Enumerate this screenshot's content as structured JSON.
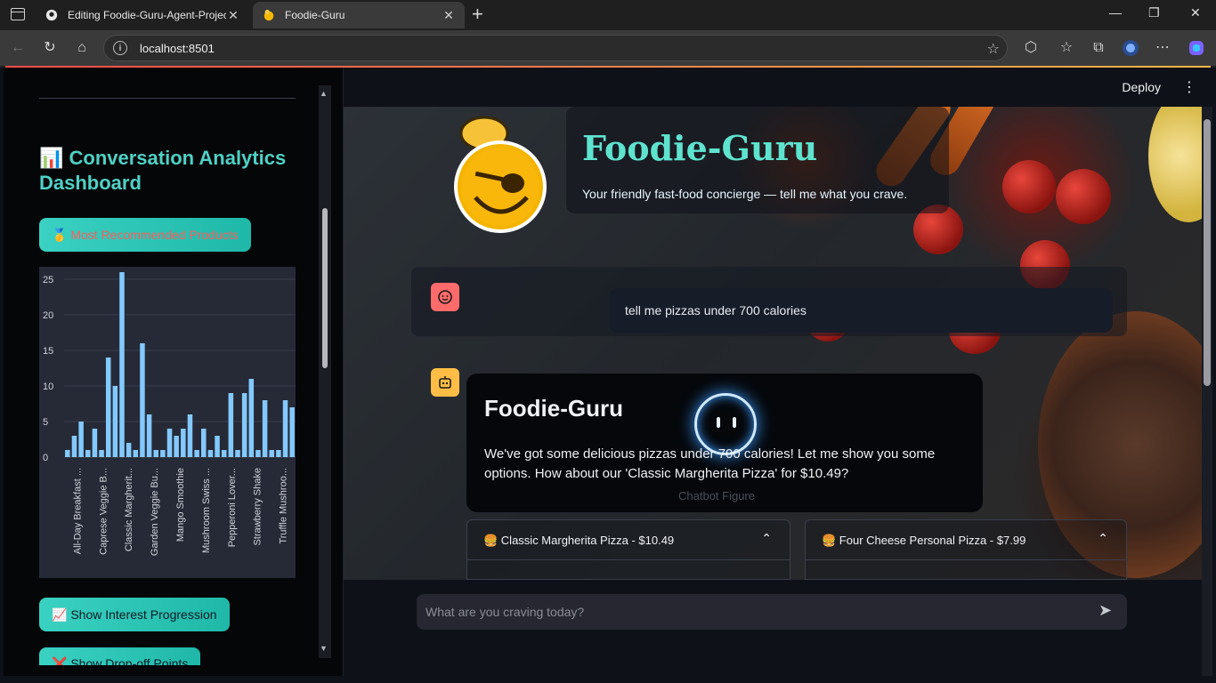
{
  "browser": {
    "tabs": [
      {
        "title": "Editing Foodie-Guru-Agent-Project",
        "icon": "github-icon",
        "active": false
      },
      {
        "title": "Foodie-Guru",
        "icon": "chef-favicon-icon",
        "active": true
      }
    ],
    "url": "localhost:8501"
  },
  "header": {
    "deploy_label": "Deploy",
    "menu_icon": "more-vertical-icon"
  },
  "sidebar": {
    "title": "📊 Conversation Analytics Dashboard",
    "buttons": {
      "recommended": "🥇 Most Recommended Products",
      "interest": "📈 Show Interest Progression",
      "dropoff": "❌ Show Drop-off Points"
    }
  },
  "chart_data": {
    "type": "bar",
    "title": "",
    "xlabel": "",
    "ylabel": "",
    "ylim": [
      0,
      26
    ],
    "yticks": [
      0,
      5,
      10,
      15,
      20,
      25
    ],
    "color": "#83c9ff",
    "tick_labels": [
      "All-Day Breakfast ...",
      "Caprese Veggie B...",
      "Classic Margherit...",
      "Garden Veggie Bu...",
      "Mango Smoothie",
      "Mushroom Swiss ...",
      "Pepperoni Lover...",
      "Strawberry Shake",
      "Truffle Mushroo..."
    ],
    "values": [
      1,
      3,
      5,
      1,
      4,
      1,
      14,
      10,
      26,
      2,
      1,
      16,
      6,
      1,
      1,
      4,
      3,
      4,
      6,
      1,
      4,
      1,
      3,
      1,
      9,
      1,
      9,
      11,
      1,
      8,
      1,
      1,
      8,
      7
    ]
  },
  "hero": {
    "title": "Foodie-Guru",
    "subtitle": "Your friendly fast-food concierge — tell me what you crave."
  },
  "chat": {
    "user_message": "tell me pizzas under 700 calories",
    "bot_name": "Foodie-Guru",
    "bot_message": "We've got some delicious pizzas under 700 calories! Let me show you some options. How about our 'Classic Margherita Pizza' for $10.49?",
    "figure_label": "Chatbot Figure",
    "products": [
      "🍔 Classic Margherita Pizza - $10.49",
      "🍔 Four Cheese Personal Pizza - $7.99"
    ],
    "input_placeholder": "What are you craving today?"
  }
}
